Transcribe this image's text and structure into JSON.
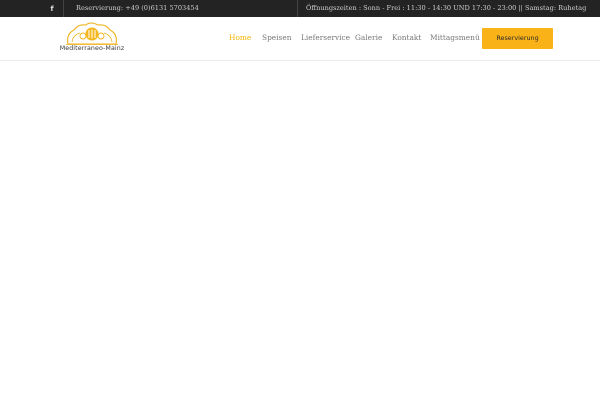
{
  "topbar": {
    "facebook_icon": "f",
    "phone": "Reservierung: +49 (0)6131 5703454",
    "hours": "Öffnungszeiten : Sonn - Frei : 11:30 - 14:30 UND 17:30 - 23:00 || Samstag: Ruhetag"
  },
  "header": {
    "logo_text": "Mediterraneo-Mainz",
    "nav": [
      {
        "label": "Home",
        "active": true
      },
      {
        "label": "Speisen",
        "active": false
      },
      {
        "label": "Lieferservice",
        "active": false
      },
      {
        "label": "Galerie",
        "active": false
      },
      {
        "label": "Kontakt",
        "active": false
      },
      {
        "label": "Mittagsmenü",
        "active": false
      }
    ],
    "cta_label": "Reservierung"
  },
  "colors": {
    "topbar_bg": "#232323",
    "accent": "#fab219",
    "active_nav": "#f4b500"
  }
}
